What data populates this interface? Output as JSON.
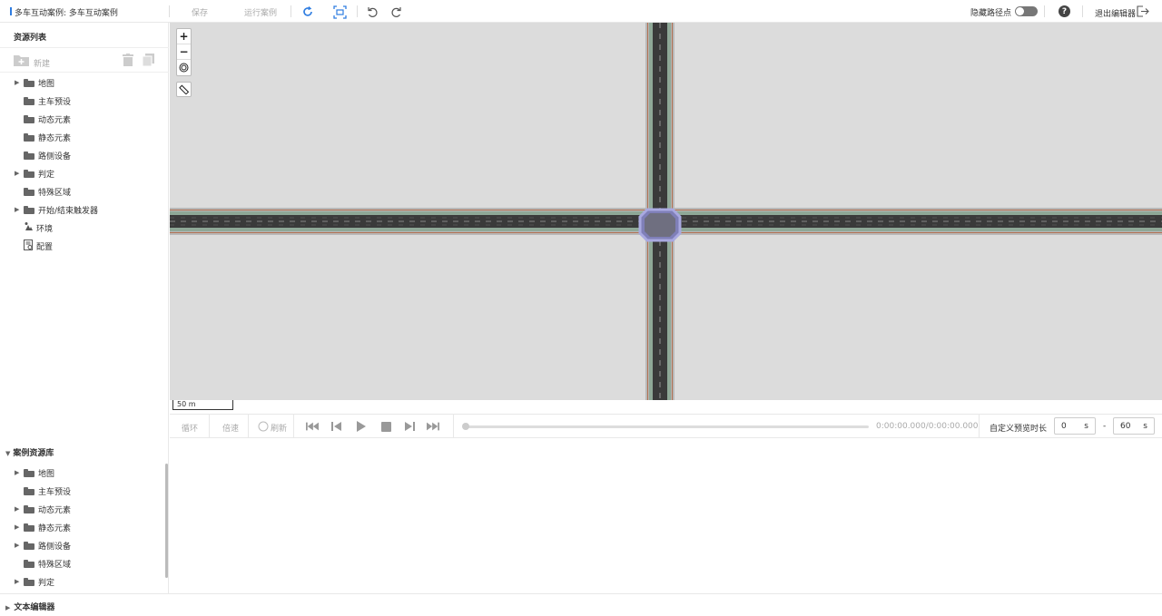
{
  "topbar": {
    "title": "多车互动案例: 多车互动案例",
    "save_label": "保存",
    "run_label": "运行案例",
    "hide_waypoints_label": "隐藏路径点",
    "help_label": "?",
    "exit_label": "退出编辑器"
  },
  "resources": {
    "heading": "资源列表",
    "new_label": "新建",
    "items": [
      {
        "label": "地图",
        "expandable": true,
        "icon": "folder-icon"
      },
      {
        "label": "主车预设",
        "expandable": false,
        "icon": "folder-icon"
      },
      {
        "label": "动态元素",
        "expandable": false,
        "icon": "folder-icon"
      },
      {
        "label": "静态元素",
        "expandable": false,
        "icon": "folder-icon"
      },
      {
        "label": "路侧设备",
        "expandable": false,
        "icon": "folder-icon"
      },
      {
        "label": "判定",
        "expandable": true,
        "icon": "folder-icon"
      },
      {
        "label": "特殊区域",
        "expandable": false,
        "icon": "folder-icon"
      },
      {
        "label": "开始/结束触发器",
        "expandable": true,
        "icon": "folder-icon"
      },
      {
        "label": "环境",
        "expandable": false,
        "icon": "environment-icon"
      },
      {
        "label": "配置",
        "expandable": false,
        "icon": "config-icon"
      }
    ]
  },
  "map": {
    "zoom_in": "+",
    "zoom_out": "−",
    "scale_label": "50 m"
  },
  "playback": {
    "loop_label": "循环",
    "speed_label": "倍速",
    "refresh_label": "刷新",
    "progress": 0,
    "time_label": "0:00:00.000/0:00:00.000",
    "preview_label": "自定义预览时长",
    "start_value": "0",
    "start_unit": "s",
    "dash": "-",
    "end_value": "60",
    "end_unit": "s"
  },
  "library": {
    "heading": "案例资源库",
    "items": [
      {
        "label": "地图",
        "expandable": true
      },
      {
        "label": "主车预设",
        "expandable": false
      },
      {
        "label": "动态元素",
        "expandable": true
      },
      {
        "label": "静态元素",
        "expandable": true
      },
      {
        "label": "路侧设备",
        "expandable": true
      },
      {
        "label": "特殊区域",
        "expandable": false
      },
      {
        "label": "判定",
        "expandable": true
      }
    ]
  },
  "text_editor": {
    "heading": "文本编辑器"
  },
  "colors": {
    "accent": "#2f7de1",
    "map_background": "#dcdcdc",
    "road": "#3a3a3a",
    "junction": "#8888cc"
  }
}
